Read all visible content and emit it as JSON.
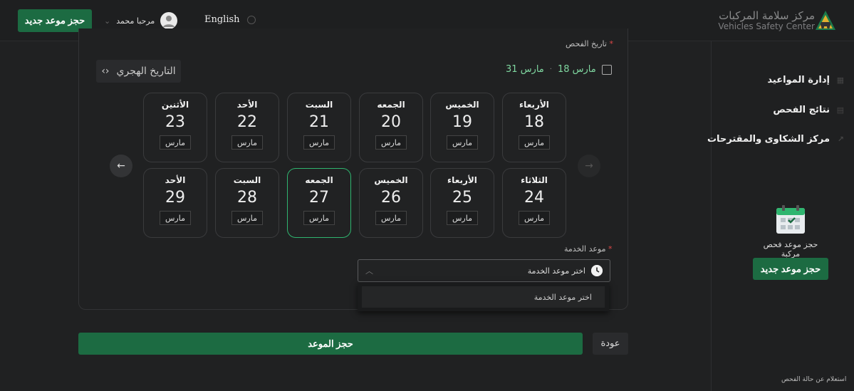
{
  "header": {
    "new_booking_label": "حجز موعد جديد",
    "user_greeting": "مرحبا محمد",
    "language_label": "English",
    "brand_ar": "مركز سلامة المركبات",
    "brand_en": "Vehicles Safety Center"
  },
  "sidebar": {
    "items": [
      {
        "label": "إدارة المواعيد"
      },
      {
        "label": "نتائج الفحص"
      },
      {
        "label": "مركز الشكاوى والمقترحات"
      }
    ],
    "promo_text": "حجز موعد فحص مركبة",
    "promo_button": "حجز موعد جديد",
    "status_link": "استعلام عن حالة الفحص"
  },
  "form": {
    "date_label": "تاريخ الفحص",
    "hijri_label": "التاريخ الهجري",
    "range_start": "18 مارس",
    "range_end": "31 مارس",
    "days": [
      {
        "name": "الأربعاء",
        "num": "18",
        "month": "مارس"
      },
      {
        "name": "الخميس",
        "num": "19",
        "month": "مارس"
      },
      {
        "name": "الجمعه",
        "num": "20",
        "month": "مارس"
      },
      {
        "name": "السبت",
        "num": "21",
        "month": "مارس"
      },
      {
        "name": "الأحد",
        "num": "22",
        "month": "مارس"
      },
      {
        "name": "الأثنين",
        "num": "23",
        "month": "مارس"
      },
      {
        "name": "الثلاثاء",
        "num": "24",
        "month": "مارس"
      },
      {
        "name": "الأربعاء",
        "num": "25",
        "month": "مارس"
      },
      {
        "name": "الخميس",
        "num": "26",
        "month": "مارس"
      },
      {
        "name": "الجمعه",
        "num": "27",
        "month": "مارس",
        "selected": true
      },
      {
        "name": "السبت",
        "num": "28",
        "month": "مارس"
      },
      {
        "name": "الأحد",
        "num": "29",
        "month": "مارس"
      }
    ],
    "service_time_label": "موعد الخدمة",
    "service_time_placeholder": "اختر موعد الخدمة",
    "dropdown_option": "اختر موعد الخدمة",
    "submit_label": "حجز الموعد",
    "back_label": "عودة"
  },
  "colors": {
    "accent_green": "#1c6b42",
    "selected_border": "#2fb56f",
    "range_text": "#7fd7a0"
  }
}
